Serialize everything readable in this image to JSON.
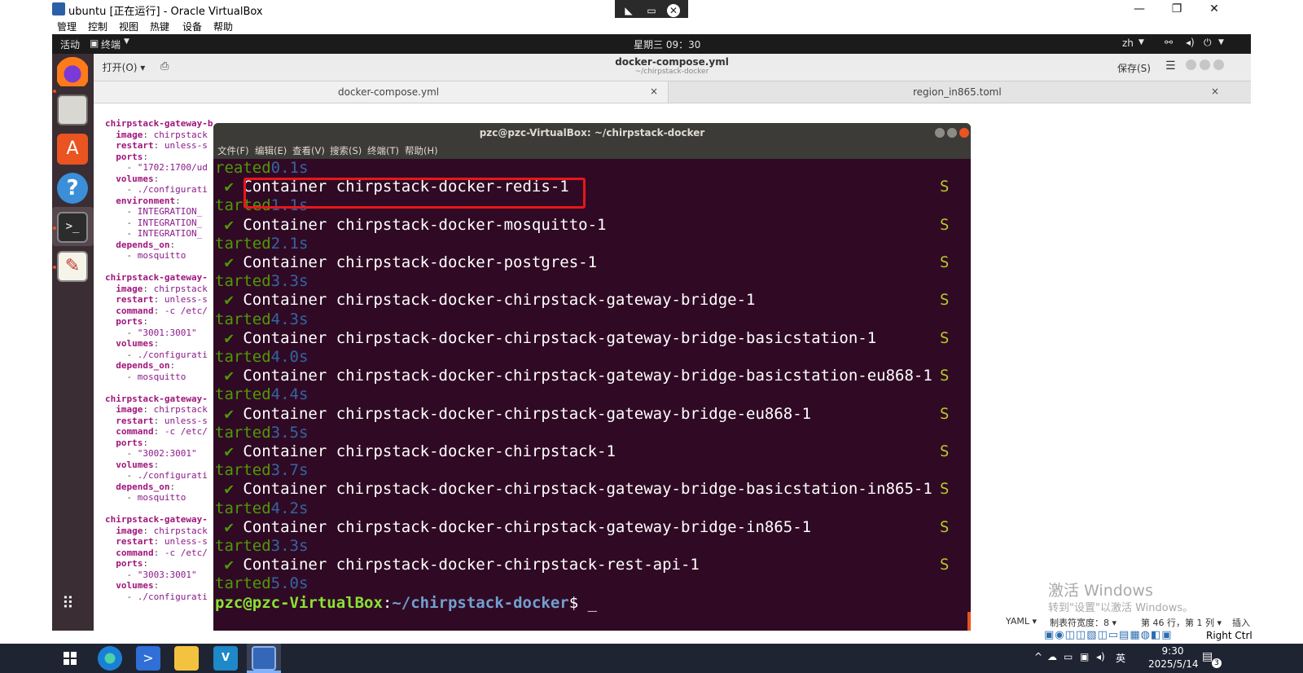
{
  "vbox": {
    "title": "ubuntu [正在运行] - Oracle VirtualBox",
    "menu": [
      "管理",
      "控制",
      "视图",
      "热键",
      "设备",
      "帮助"
    ],
    "window_controls": [
      "—",
      "❐",
      "✕"
    ],
    "status_host_key": "Right Ctrl"
  },
  "ubuntu_topbar": {
    "activities": "活动",
    "app_menu": "终端",
    "clock": "星期三 09：30",
    "lang": "zh"
  },
  "gedit": {
    "open_label": "打开(O)",
    "title": "docker-compose.yml",
    "subtitle": "~/chirpstack-docker",
    "save_label": "保存(S)",
    "tabs": [
      {
        "label": "docker-compose.yml",
        "close": "×"
      },
      {
        "label": "region_in865.toml",
        "close": "×"
      }
    ],
    "status": {
      "lang": "YAML",
      "tab_width": "制表符宽度：8",
      "position": "第 46 行，第 1 列",
      "mode": "插入"
    }
  },
  "terminal": {
    "title": "pzc@pzc-VirtualBox: ~/chirpstack-docker",
    "menu": [
      "文件(F)",
      "编辑(E)",
      "查看(V)",
      "搜索(S)",
      "终端(T)",
      "帮助(H)"
    ],
    "first_status": {
      "word": "reated",
      "time": "0.1s"
    },
    "containers": [
      {
        "name": "Container chirpstack-docker-redis-1",
        "status_word": "tarted",
        "time": "1.1s"
      },
      {
        "name": "Container chirpstack-docker-mosquitto-1",
        "status_word": "tarted",
        "time": "2.1s"
      },
      {
        "name": "Container chirpstack-docker-postgres-1",
        "status_word": "tarted",
        "time": "3.3s"
      },
      {
        "name": "Container chirpstack-docker-chirpstack-gateway-bridge-1",
        "status_word": "tarted",
        "time": "4.3s"
      },
      {
        "name": "Container chirpstack-docker-chirpstack-gateway-bridge-basicstation-1",
        "status_word": "tarted",
        "time": "4.0s"
      },
      {
        "name": "Container chirpstack-docker-chirpstack-gateway-bridge-basicstation-eu868-1",
        "status_word": "tarted",
        "time": "4.4s"
      },
      {
        "name": "Container chirpstack-docker-chirpstack-gateway-bridge-eu868-1",
        "status_word": "tarted",
        "time": "3.5s"
      },
      {
        "name": "Container chirpstack-docker-chirpstack-1",
        "status_word": "tarted",
        "time": "3.7s"
      },
      {
        "name": "Container chirpstack-docker-chirpstack-gateway-bridge-basicstation-in865-1",
        "status_word": "tarted",
        "time": "4.2s"
      },
      {
        "name": "Container chirpstack-docker-chirpstack-gateway-bridge-in865-1",
        "status_word": "tarted",
        "time": "3.3s"
      },
      {
        "name": "Container chirpstack-docker-chirpstack-rest-api-1",
        "status_word": "tarted",
        "time": "5.0s"
      }
    ],
    "check": "✔",
    "trailing": "S",
    "prompt_user": "pzc@pzc-VirtualBox",
    "prompt_path": "~/chirpstack-docker",
    "prompt_symbol": "$"
  },
  "watermark": {
    "line1": "激活 Windows",
    "line2": "转到\"设置\"以激活 Windows。"
  },
  "taskbar": {
    "time": "9:30",
    "date": "2025/5/14",
    "ime": "英",
    "notification_count": "3"
  },
  "colors": {
    "terminal_bg": "#300a24",
    "highlight_box": "#e8161c",
    "ubuntu_orange": "#e95420"
  }
}
